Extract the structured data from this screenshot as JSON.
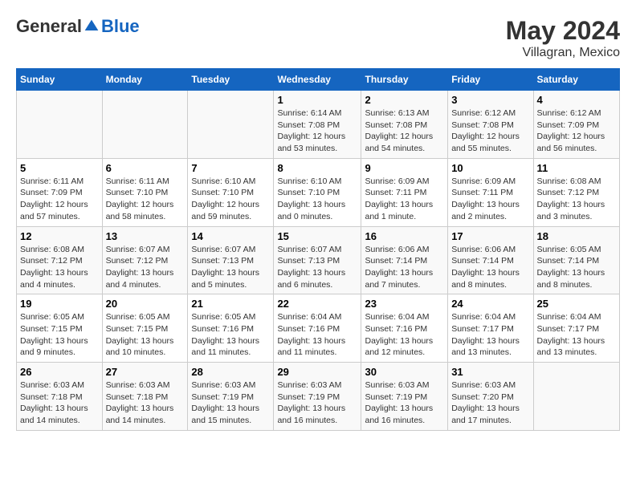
{
  "logo": {
    "general": "General",
    "blue": "Blue"
  },
  "title": {
    "month_year": "May 2024",
    "location": "Villagran, Mexico"
  },
  "days_of_week": [
    "Sunday",
    "Monday",
    "Tuesday",
    "Wednesday",
    "Thursday",
    "Friday",
    "Saturday"
  ],
  "weeks": [
    [
      {
        "day": "",
        "info": ""
      },
      {
        "day": "",
        "info": ""
      },
      {
        "day": "",
        "info": ""
      },
      {
        "day": "1",
        "info": "Sunrise: 6:14 AM\nSunset: 7:08 PM\nDaylight: 12 hours and 53 minutes."
      },
      {
        "day": "2",
        "info": "Sunrise: 6:13 AM\nSunset: 7:08 PM\nDaylight: 12 hours and 54 minutes."
      },
      {
        "day": "3",
        "info": "Sunrise: 6:12 AM\nSunset: 7:08 PM\nDaylight: 12 hours and 55 minutes."
      },
      {
        "day": "4",
        "info": "Sunrise: 6:12 AM\nSunset: 7:09 PM\nDaylight: 12 hours and 56 minutes."
      }
    ],
    [
      {
        "day": "5",
        "info": "Sunrise: 6:11 AM\nSunset: 7:09 PM\nDaylight: 12 hours and 57 minutes."
      },
      {
        "day": "6",
        "info": "Sunrise: 6:11 AM\nSunset: 7:10 PM\nDaylight: 12 hours and 58 minutes."
      },
      {
        "day": "7",
        "info": "Sunrise: 6:10 AM\nSunset: 7:10 PM\nDaylight: 12 hours and 59 minutes."
      },
      {
        "day": "8",
        "info": "Sunrise: 6:10 AM\nSunset: 7:10 PM\nDaylight: 13 hours and 0 minutes."
      },
      {
        "day": "9",
        "info": "Sunrise: 6:09 AM\nSunset: 7:11 PM\nDaylight: 13 hours and 1 minute."
      },
      {
        "day": "10",
        "info": "Sunrise: 6:09 AM\nSunset: 7:11 PM\nDaylight: 13 hours and 2 minutes."
      },
      {
        "day": "11",
        "info": "Sunrise: 6:08 AM\nSunset: 7:12 PM\nDaylight: 13 hours and 3 minutes."
      }
    ],
    [
      {
        "day": "12",
        "info": "Sunrise: 6:08 AM\nSunset: 7:12 PM\nDaylight: 13 hours and 4 minutes."
      },
      {
        "day": "13",
        "info": "Sunrise: 6:07 AM\nSunset: 7:12 PM\nDaylight: 13 hours and 4 minutes."
      },
      {
        "day": "14",
        "info": "Sunrise: 6:07 AM\nSunset: 7:13 PM\nDaylight: 13 hours and 5 minutes."
      },
      {
        "day": "15",
        "info": "Sunrise: 6:07 AM\nSunset: 7:13 PM\nDaylight: 13 hours and 6 minutes."
      },
      {
        "day": "16",
        "info": "Sunrise: 6:06 AM\nSunset: 7:14 PM\nDaylight: 13 hours and 7 minutes."
      },
      {
        "day": "17",
        "info": "Sunrise: 6:06 AM\nSunset: 7:14 PM\nDaylight: 13 hours and 8 minutes."
      },
      {
        "day": "18",
        "info": "Sunrise: 6:05 AM\nSunset: 7:14 PM\nDaylight: 13 hours and 8 minutes."
      }
    ],
    [
      {
        "day": "19",
        "info": "Sunrise: 6:05 AM\nSunset: 7:15 PM\nDaylight: 13 hours and 9 minutes."
      },
      {
        "day": "20",
        "info": "Sunrise: 6:05 AM\nSunset: 7:15 PM\nDaylight: 13 hours and 10 minutes."
      },
      {
        "day": "21",
        "info": "Sunrise: 6:05 AM\nSunset: 7:16 PM\nDaylight: 13 hours and 11 minutes."
      },
      {
        "day": "22",
        "info": "Sunrise: 6:04 AM\nSunset: 7:16 PM\nDaylight: 13 hours and 11 minutes."
      },
      {
        "day": "23",
        "info": "Sunrise: 6:04 AM\nSunset: 7:16 PM\nDaylight: 13 hours and 12 minutes."
      },
      {
        "day": "24",
        "info": "Sunrise: 6:04 AM\nSunset: 7:17 PM\nDaylight: 13 hours and 13 minutes."
      },
      {
        "day": "25",
        "info": "Sunrise: 6:04 AM\nSunset: 7:17 PM\nDaylight: 13 hours and 13 minutes."
      }
    ],
    [
      {
        "day": "26",
        "info": "Sunrise: 6:03 AM\nSunset: 7:18 PM\nDaylight: 13 hours and 14 minutes."
      },
      {
        "day": "27",
        "info": "Sunrise: 6:03 AM\nSunset: 7:18 PM\nDaylight: 13 hours and 14 minutes."
      },
      {
        "day": "28",
        "info": "Sunrise: 6:03 AM\nSunset: 7:19 PM\nDaylight: 13 hours and 15 minutes."
      },
      {
        "day": "29",
        "info": "Sunrise: 6:03 AM\nSunset: 7:19 PM\nDaylight: 13 hours and 16 minutes."
      },
      {
        "day": "30",
        "info": "Sunrise: 6:03 AM\nSunset: 7:19 PM\nDaylight: 13 hours and 16 minutes."
      },
      {
        "day": "31",
        "info": "Sunrise: 6:03 AM\nSunset: 7:20 PM\nDaylight: 13 hours and 17 minutes."
      },
      {
        "day": "",
        "info": ""
      }
    ]
  ]
}
